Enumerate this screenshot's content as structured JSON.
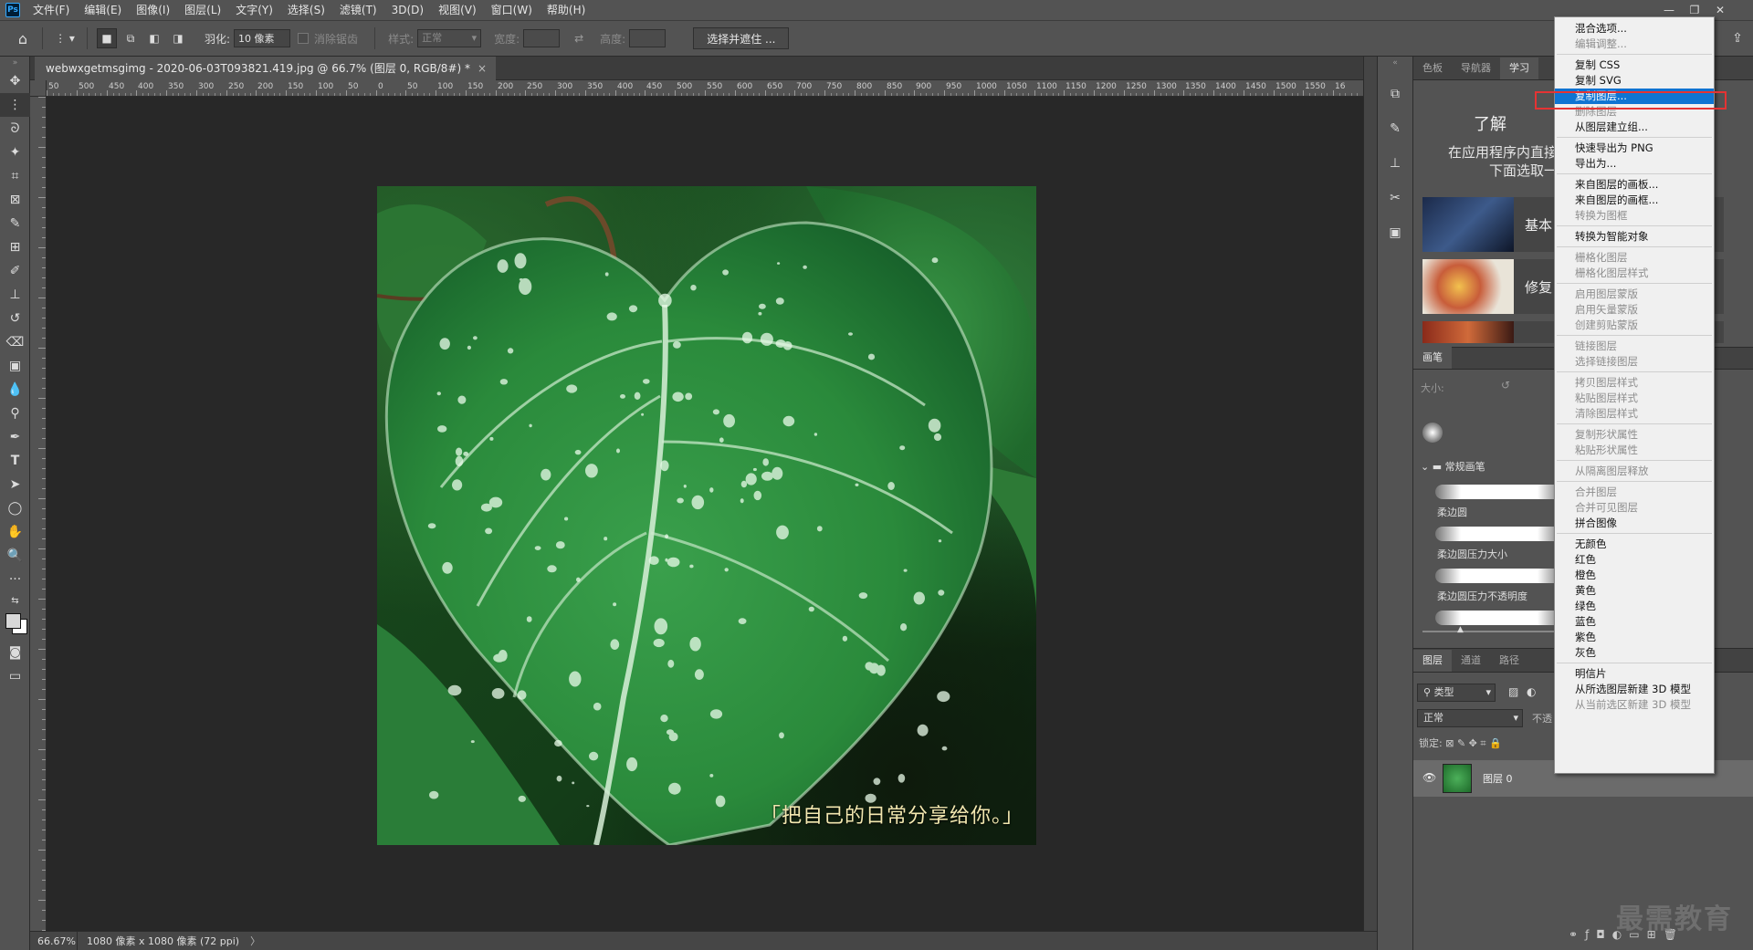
{
  "menubar": {
    "logo": "Ps",
    "items": [
      "文件(F)",
      "编辑(E)",
      "图像(I)",
      "图层(L)",
      "文字(Y)",
      "选择(S)",
      "滤镜(T)",
      "3D(D)",
      "视图(V)",
      "窗口(W)",
      "帮助(H)"
    ]
  },
  "options": {
    "feather_label": "羽化:",
    "feather_value": "10 像素",
    "antialias_label": "消除锯齿",
    "style_label": "样式:",
    "style_value": "正常",
    "width_label": "宽度:",
    "height_label": "高度:",
    "select_mask_button": "选择并遮住 ..."
  },
  "document": {
    "tab_title": "webwxgetmsgimg - 2020-06-03T093821.419.jpg @ 66.7% (图层 0, RGB/8#) *",
    "close": "×",
    "caption": "「把自己的日常分享给你。」"
  },
  "ruler": {
    "h_labels": [
      "50",
      "500",
      "450",
      "400",
      "350",
      "300",
      "250",
      "200",
      "150",
      "100",
      "50",
      "0",
      "50",
      "100",
      "150",
      "200",
      "250",
      "300",
      "350",
      "400",
      "450",
      "500",
      "550",
      "600",
      "650",
      "700",
      "750",
      "800",
      "850",
      "900",
      "950",
      "1000",
      "1050",
      "1100",
      "1150",
      "1200",
      "1250",
      "1300",
      "1350",
      "1400",
      "1450",
      "1500",
      "1550",
      "16"
    ]
  },
  "status": {
    "zoom": "66.67%",
    "info": "1080 像素 x 1080 像素 (72 ppi)",
    "arrow": "〉"
  },
  "panels": {
    "top_tabs": [
      "色板",
      "导航器",
      "学习"
    ],
    "learn_title": "了解",
    "learn_line1": "在应用程序内直接",
    "learn_line2": "下面选取一",
    "thumb1_label": "基本",
    "thumb2_label": "修复",
    "brush_tab": "画笔",
    "size_label": "大小:",
    "brush_group": "常规画笔",
    "brushes": [
      "柔边圆",
      "柔边圆压力大小",
      "柔边圆压力不透明度"
    ],
    "layer_tabs": [
      "图层",
      "通道",
      "路径"
    ],
    "filter_kind": "类型",
    "blend_mode": "正常",
    "opacity_label": "不透",
    "lock_label": "锁定:",
    "layer_name": "图层 0"
  },
  "context_menu": {
    "items": [
      {
        "label": "混合选项...",
        "state": "normal"
      },
      {
        "label": "编辑调整...",
        "state": "disabled"
      },
      {
        "label": "复制 CSS",
        "state": "normal"
      },
      {
        "label": "复制 SVG",
        "state": "normal"
      },
      {
        "label": "复制图层...",
        "state": "selected"
      },
      {
        "label": "删除图层",
        "state": "disabled"
      },
      {
        "label": "从图层建立组...",
        "state": "normal"
      },
      {
        "label": "快速导出为 PNG",
        "state": "normal"
      },
      {
        "label": "导出为...",
        "state": "normal"
      },
      {
        "label": "来自图层的画板...",
        "state": "normal"
      },
      {
        "label": "来自图层的画框...",
        "state": "normal"
      },
      {
        "label": "转换为图框",
        "state": "disabled"
      },
      {
        "label": "转换为智能对象",
        "state": "normal"
      },
      {
        "label": "栅格化图层",
        "state": "disabled"
      },
      {
        "label": "栅格化图层样式",
        "state": "disabled"
      },
      {
        "label": "启用图层蒙版",
        "state": "disabled"
      },
      {
        "label": "启用矢量蒙版",
        "state": "disabled"
      },
      {
        "label": "创建剪贴蒙版",
        "state": "disabled"
      },
      {
        "label": "链接图层",
        "state": "disabled"
      },
      {
        "label": "选择链接图层",
        "state": "disabled"
      },
      {
        "label": "拷贝图层样式",
        "state": "disabled"
      },
      {
        "label": "粘贴图层样式",
        "state": "disabled"
      },
      {
        "label": "清除图层样式",
        "state": "disabled"
      },
      {
        "label": "复制形状属性",
        "state": "disabled"
      },
      {
        "label": "粘贴形状属性",
        "state": "disabled"
      },
      {
        "label": "从隔离图层释放",
        "state": "disabled"
      },
      {
        "label": "合并图层",
        "state": "disabled"
      },
      {
        "label": "合并可见图层",
        "state": "disabled"
      },
      {
        "label": "拼合图像",
        "state": "normal"
      },
      {
        "label": "无颜色",
        "state": "normal"
      },
      {
        "label": "红色",
        "state": "normal"
      },
      {
        "label": "橙色",
        "state": "normal"
      },
      {
        "label": "黄色",
        "state": "normal"
      },
      {
        "label": "绿色",
        "state": "normal"
      },
      {
        "label": "蓝色",
        "state": "normal"
      },
      {
        "label": "紫色",
        "state": "normal"
      },
      {
        "label": "灰色",
        "state": "normal"
      },
      {
        "label": "明信片",
        "state": "normal"
      },
      {
        "label": "从所选图层新建 3D 模型",
        "state": "normal"
      },
      {
        "label": "从当前选区新建 3D 模型",
        "state": "disabled"
      }
    ]
  },
  "watermark": "最需教育",
  "colors": {
    "selection_blue": "#0f74d2",
    "highlight_red": "#e53333",
    "leaf_green": "#2f8f3e"
  }
}
